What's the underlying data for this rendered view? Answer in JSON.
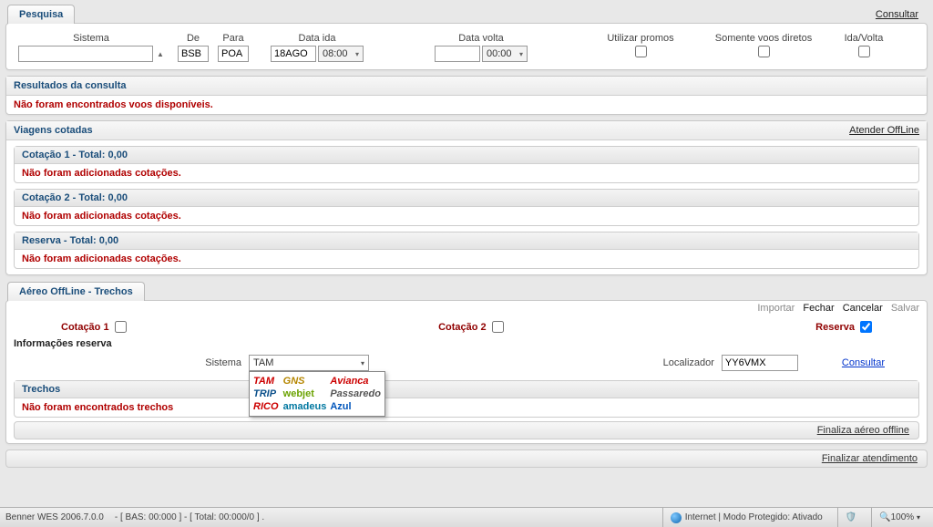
{
  "pesquisa": {
    "tab": "Pesquisa",
    "consultar": "Consultar",
    "cols": {
      "sistema": "Sistema",
      "de": "De",
      "de_val": "BSB",
      "para": "Para",
      "para_val": "POA",
      "data_ida": "Data ida",
      "data_ida_val": "18AGO",
      "hora_ida": "08:00",
      "data_volta": "Data volta",
      "data_volta_val": "",
      "hora_volta": "00:00",
      "promos": "Utilizar promos",
      "diretos": "Somente voos diretos",
      "idavolta": "Ida/Volta"
    }
  },
  "resultados": {
    "title": "Resultados da consulta",
    "msg": "Não foram encontrados voos disponíveis."
  },
  "viagens": {
    "title": "Viagens cotadas",
    "atender": "Atender OffLine",
    "cot1": "Cotação 1 - Total: 0,00",
    "cot2": "Cotação 2 - Total: 0,00",
    "reserva": "Reserva - Total: 0,00",
    "msg": "Não foram adicionadas cotações."
  },
  "offline": {
    "tab": "Aéreo OffLine - Trechos",
    "actions": {
      "importar": "Importar",
      "fechar": "Fechar",
      "cancelar": "Cancelar",
      "salvar": "Salvar"
    },
    "sel": {
      "cot1": "Cotação 1",
      "cot2": "Cotação 2",
      "reserva": "Reserva"
    },
    "info": "Informações reserva",
    "sistema_lbl": "Sistema",
    "sistema_val": "TAM",
    "loc_lbl": "Localizador",
    "loc_val": "YY6VMX",
    "consultar": "Consultar",
    "dropdown": [
      "TAM",
      "GNS",
      "Avianca",
      "TRIP",
      "webjet",
      "Passaredo",
      "RICO",
      "amadeus",
      "Azul"
    ],
    "trechos": "Trechos",
    "trechos_msg": "Não foram encontrados trechos",
    "finaliza": "Finaliza aéreo offline"
  },
  "finalizar": "Finalizar atendimento",
  "status": {
    "app": "Benner WES 2006.7.0.0",
    "info": "- [ BAS: 00:000 ] - [ Total: 00:000/0 ] .",
    "net": "Internet | Modo Protegido: Ativado",
    "zoom": "100%"
  }
}
